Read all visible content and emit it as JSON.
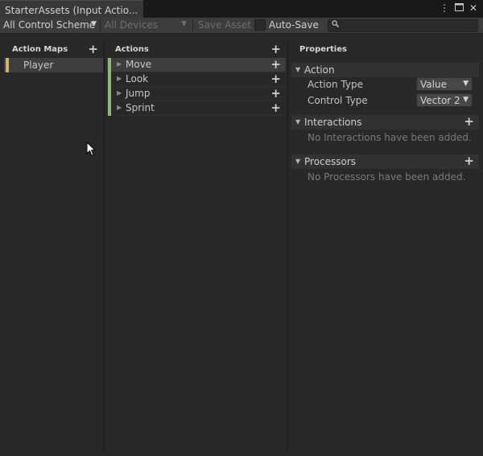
{
  "window": {
    "tab_title": "StarterAssets (Input Actio...",
    "icons": [
      "more-icon",
      "maximize-icon",
      "close-icon"
    ]
  },
  "toolbar": {
    "control_scheme": "All Control Scheme",
    "devices": "All Devices",
    "save_asset": "Save Asset",
    "auto_save": "Auto-Save",
    "search_placeholder": ""
  },
  "action_maps": {
    "header": "Action Maps",
    "items": [
      {
        "label": "Player",
        "color": "#cdb56a"
      }
    ]
  },
  "actions": {
    "header": "Actions",
    "items": [
      {
        "label": "Move",
        "selected": true
      },
      {
        "label": "Look",
        "selected": false
      },
      {
        "label": "Jump",
        "selected": false
      },
      {
        "label": "Sprint",
        "selected": false
      }
    ],
    "bar_color": "#8fb779"
  },
  "properties": {
    "header": "Properties",
    "action_section": "Action",
    "action_type_label": "Action Type",
    "action_type_value": "Value",
    "control_type_label": "Control Type",
    "control_type_value": "Vector 2",
    "interactions_section": "Interactions",
    "interactions_empty": "No Interactions have been added.",
    "processors_section": "Processors",
    "processors_empty": "No Processors have been added."
  }
}
